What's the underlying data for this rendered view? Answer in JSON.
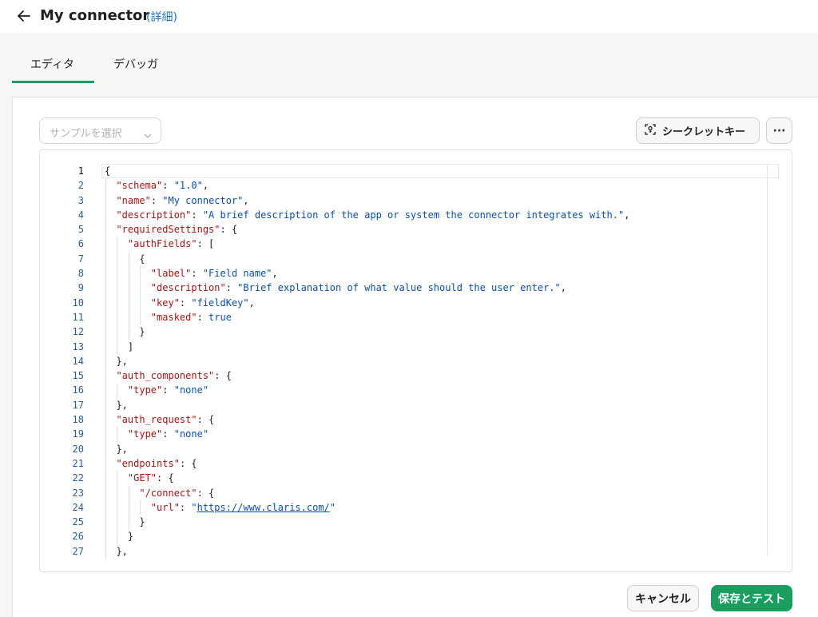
{
  "header": {
    "title": "My connector",
    "details_link": "(詳細)"
  },
  "tabs": [
    {
      "label": "エディタ",
      "active": true
    },
    {
      "label": "デバッガ",
      "active": false
    }
  ],
  "toolbar": {
    "sample_select_placeholder": "サンプルを選択",
    "secret_key_label": "シークレットキー",
    "more_label": "···"
  },
  "editor": {
    "line_numbers": [
      "1",
      "2",
      "3",
      "4",
      "5",
      "6",
      "7",
      "8",
      "9",
      "10",
      "11",
      "12",
      "13",
      "14",
      "15",
      "16",
      "17",
      "18",
      "19",
      "20",
      "21",
      "22",
      "23",
      "24",
      "25",
      "26",
      "27"
    ],
    "lines": [
      {
        "indent": "",
        "parts": [
          {
            "t": "{",
            "c": "p"
          }
        ]
      },
      {
        "indent": "  ",
        "parts": [
          {
            "t": "\"schema\"",
            "c": "k"
          },
          {
            "t": ": ",
            "c": "p"
          },
          {
            "t": "\"1.0\"",
            "c": "s"
          },
          {
            "t": ",",
            "c": "p"
          }
        ]
      },
      {
        "indent": "  ",
        "parts": [
          {
            "t": "\"name\"",
            "c": "k"
          },
          {
            "t": ": ",
            "c": "p"
          },
          {
            "t": "\"My connector\"",
            "c": "s"
          },
          {
            "t": ",",
            "c": "p"
          }
        ]
      },
      {
        "indent": "  ",
        "parts": [
          {
            "t": "\"description\"",
            "c": "k"
          },
          {
            "t": ": ",
            "c": "p"
          },
          {
            "t": "\"A brief description of the app or system the connector integrates with.\"",
            "c": "s"
          },
          {
            "t": ",",
            "c": "p"
          }
        ]
      },
      {
        "indent": "  ",
        "parts": [
          {
            "t": "\"requiredSettings\"",
            "c": "k"
          },
          {
            "t": ": {",
            "c": "p"
          }
        ]
      },
      {
        "indent": "    ",
        "parts": [
          {
            "t": "\"authFields\"",
            "c": "k"
          },
          {
            "t": ": [",
            "c": "p"
          }
        ]
      },
      {
        "indent": "      ",
        "parts": [
          {
            "t": "{",
            "c": "p"
          }
        ]
      },
      {
        "indent": "        ",
        "parts": [
          {
            "t": "\"label\"",
            "c": "k"
          },
          {
            "t": ": ",
            "c": "p"
          },
          {
            "t": "\"Field name\"",
            "c": "s"
          },
          {
            "t": ",",
            "c": "p"
          }
        ]
      },
      {
        "indent": "        ",
        "parts": [
          {
            "t": "\"description\"",
            "c": "k"
          },
          {
            "t": ": ",
            "c": "p"
          },
          {
            "t": "\"Brief explanation of what value should the user enter.\"",
            "c": "s"
          },
          {
            "t": ",",
            "c": "p"
          }
        ]
      },
      {
        "indent": "        ",
        "parts": [
          {
            "t": "\"key\"",
            "c": "k"
          },
          {
            "t": ": ",
            "c": "p"
          },
          {
            "t": "\"fieldKey\"",
            "c": "s"
          },
          {
            "t": ",",
            "c": "p"
          }
        ]
      },
      {
        "indent": "        ",
        "parts": [
          {
            "t": "\"masked\"",
            "c": "k"
          },
          {
            "t": ": ",
            "c": "p"
          },
          {
            "t": "true",
            "c": "b"
          }
        ]
      },
      {
        "indent": "      ",
        "parts": [
          {
            "t": "}",
            "c": "p"
          }
        ]
      },
      {
        "indent": "    ",
        "parts": [
          {
            "t": "]",
            "c": "p"
          }
        ]
      },
      {
        "indent": "  ",
        "parts": [
          {
            "t": "},",
            "c": "p"
          }
        ]
      },
      {
        "indent": "  ",
        "parts": [
          {
            "t": "\"auth_components\"",
            "c": "k"
          },
          {
            "t": ": {",
            "c": "p"
          }
        ]
      },
      {
        "indent": "    ",
        "parts": [
          {
            "t": "\"type\"",
            "c": "k"
          },
          {
            "t": ": ",
            "c": "p"
          },
          {
            "t": "\"none\"",
            "c": "s"
          }
        ]
      },
      {
        "indent": "  ",
        "parts": [
          {
            "t": "},",
            "c": "p"
          }
        ]
      },
      {
        "indent": "  ",
        "parts": [
          {
            "t": "\"auth_request\"",
            "c": "k"
          },
          {
            "t": ": {",
            "c": "p"
          }
        ]
      },
      {
        "indent": "    ",
        "parts": [
          {
            "t": "\"type\"",
            "c": "k"
          },
          {
            "t": ": ",
            "c": "p"
          },
          {
            "t": "\"none\"",
            "c": "s"
          }
        ]
      },
      {
        "indent": "  ",
        "parts": [
          {
            "t": "},",
            "c": "p"
          }
        ]
      },
      {
        "indent": "  ",
        "parts": [
          {
            "t": "\"endpoints\"",
            "c": "k"
          },
          {
            "t": ": {",
            "c": "p"
          }
        ]
      },
      {
        "indent": "    ",
        "parts": [
          {
            "t": "\"GET\"",
            "c": "k"
          },
          {
            "t": ": {",
            "c": "p"
          }
        ]
      },
      {
        "indent": "      ",
        "parts": [
          {
            "t": "\"/connect\"",
            "c": "k"
          },
          {
            "t": ": {",
            "c": "p"
          }
        ]
      },
      {
        "indent": "        ",
        "parts": [
          {
            "t": "\"url\"",
            "c": "k"
          },
          {
            "t": ": ",
            "c": "p"
          },
          {
            "t": "\"",
            "c": "s"
          },
          {
            "t": "https://www.claris.com/",
            "c": "u"
          },
          {
            "t": "\"",
            "c": "s"
          }
        ]
      },
      {
        "indent": "      ",
        "parts": [
          {
            "t": "}",
            "c": "p"
          }
        ]
      },
      {
        "indent": "    ",
        "parts": [
          {
            "t": "}",
            "c": "p"
          }
        ]
      },
      {
        "indent": "  ",
        "parts": [
          {
            "t": "},",
            "c": "p"
          }
        ]
      }
    ]
  },
  "footer": {
    "cancel_label": "キャンセル",
    "save_test_label": "保存とテスト"
  },
  "colors": {
    "accent": "#1a9d5f",
    "link": "#1a73c9",
    "json_key": "#a31515",
    "json_value": "#0b4fa3"
  }
}
